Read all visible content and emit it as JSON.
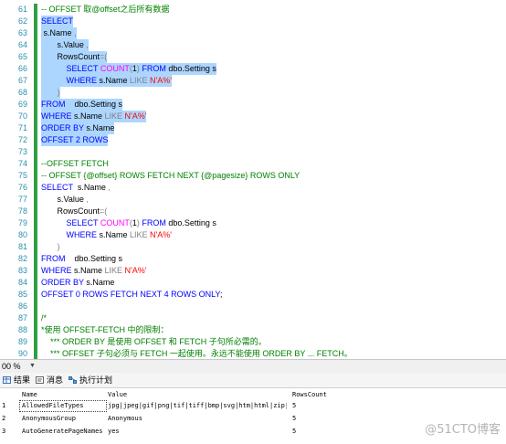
{
  "editor": {
    "lines": [
      {
        "n": "61",
        "sel": false,
        "tokens": [
          {
            "t": "-- OFFSET 取@offset之后所有数据",
            "c": "cm"
          }
        ]
      },
      {
        "n": "62",
        "sel": true,
        "tokens": [
          {
            "t": "SELECT",
            "c": "kw"
          }
        ]
      },
      {
        "n": "63",
        "sel": true,
        "tokens": [
          {
            "t": " s.Name ",
            "c": ""
          },
          {
            "t": ",",
            "c": "op"
          }
        ]
      },
      {
        "n": "64",
        "sel": true,
        "tokens": [
          {
            "t": "       s.Value ",
            "c": ""
          },
          {
            "t": ",",
            "c": "op"
          }
        ]
      },
      {
        "n": "65",
        "sel": true,
        "tokens": [
          {
            "t": "       RowsCount",
            "c": ""
          },
          {
            "t": "=(",
            "c": "op"
          }
        ]
      },
      {
        "n": "66",
        "sel": true,
        "tokens": [
          {
            "t": "           ",
            "c": ""
          },
          {
            "t": "SELECT ",
            "c": "kw"
          },
          {
            "t": "COUNT",
            "c": "fn"
          },
          {
            "t": "(",
            "c": "op"
          },
          {
            "t": "1",
            "c": ""
          },
          {
            "t": ") ",
            "c": "op"
          },
          {
            "t": "FROM ",
            "c": "kw"
          },
          {
            "t": "dbo.Setting s",
            "c": ""
          }
        ]
      },
      {
        "n": "67",
        "sel": true,
        "tokens": [
          {
            "t": "           ",
            "c": ""
          },
          {
            "t": "WHERE ",
            "c": "kw"
          },
          {
            "t": "s.Name ",
            "c": ""
          },
          {
            "t": "LIKE ",
            "c": "op"
          },
          {
            "t": "N'A%'",
            "c": "str"
          }
        ]
      },
      {
        "n": "68",
        "sel": true,
        "tokens": [
          {
            "t": "       ",
            "c": ""
          },
          {
            "t": ")",
            "c": "op"
          }
        ]
      },
      {
        "n": "69",
        "sel": true,
        "tokens": [
          {
            "t": "FROM ",
            "c": "kw"
          },
          {
            "t": "   dbo.Setting s",
            "c": ""
          }
        ]
      },
      {
        "n": "70",
        "sel": true,
        "tokens": [
          {
            "t": "WHERE ",
            "c": "kw"
          },
          {
            "t": "s.Name ",
            "c": ""
          },
          {
            "t": "LIKE ",
            "c": "op"
          },
          {
            "t": "N'A%'",
            "c": "str"
          }
        ]
      },
      {
        "n": "71",
        "sel": true,
        "tokens": [
          {
            "t": "ORDER BY ",
            "c": "kw"
          },
          {
            "t": "s.Name",
            "c": ""
          }
        ]
      },
      {
        "n": "72",
        "sel": true,
        "tokens": [
          {
            "t": "OFFSET 2 ROWS",
            "c": "kw"
          }
        ]
      },
      {
        "n": "73",
        "sel": false,
        "tokens": []
      },
      {
        "n": "74",
        "sel": false,
        "tokens": [
          {
            "t": "--OFFSET FETCH",
            "c": "cm"
          }
        ]
      },
      {
        "n": "75",
        "sel": false,
        "tokens": [
          {
            "t": "-- OFFSET {@offset} ROWS FETCH NEXT {@pagesize} ROWS ONLY",
            "c": "cm"
          }
        ]
      },
      {
        "n": "76",
        "sel": false,
        "tokens": [
          {
            "t": "SELECT ",
            "c": "kw"
          },
          {
            "t": " s.Name ",
            "c": ""
          },
          {
            "t": ",",
            "c": "op"
          }
        ]
      },
      {
        "n": "77",
        "sel": false,
        "tokens": [
          {
            "t": "       s.Value ",
            "c": ""
          },
          {
            "t": ",",
            "c": "op"
          }
        ]
      },
      {
        "n": "78",
        "sel": false,
        "tokens": [
          {
            "t": "       RowsCount",
            "c": ""
          },
          {
            "t": "=(",
            "c": "op"
          }
        ]
      },
      {
        "n": "79",
        "sel": false,
        "tokens": [
          {
            "t": "           ",
            "c": ""
          },
          {
            "t": "SELECT ",
            "c": "kw"
          },
          {
            "t": "COUNT",
            "c": "fn"
          },
          {
            "t": "(",
            "c": "op"
          },
          {
            "t": "1",
            "c": ""
          },
          {
            "t": ") ",
            "c": "op"
          },
          {
            "t": "FROM ",
            "c": "kw"
          },
          {
            "t": "dbo.Setting s",
            "c": ""
          }
        ]
      },
      {
        "n": "80",
        "sel": false,
        "tokens": [
          {
            "t": "           ",
            "c": ""
          },
          {
            "t": "WHERE ",
            "c": "kw"
          },
          {
            "t": "s.Name ",
            "c": ""
          },
          {
            "t": "LIKE ",
            "c": "op"
          },
          {
            "t": "N'A%'",
            "c": "str"
          }
        ]
      },
      {
        "n": "81",
        "sel": false,
        "tokens": [
          {
            "t": "       ",
            "c": ""
          },
          {
            "t": ")",
            "c": "op"
          }
        ]
      },
      {
        "n": "82",
        "sel": false,
        "tokens": [
          {
            "t": "FROM ",
            "c": "kw"
          },
          {
            "t": "   dbo.Setting s",
            "c": ""
          }
        ]
      },
      {
        "n": "83",
        "sel": false,
        "tokens": [
          {
            "t": "WHERE ",
            "c": "kw"
          },
          {
            "t": "s.Name ",
            "c": ""
          },
          {
            "t": "LIKE ",
            "c": "op"
          },
          {
            "t": "N'A%'",
            "c": "str"
          }
        ]
      },
      {
        "n": "84",
        "sel": false,
        "tokens": [
          {
            "t": "ORDER BY ",
            "c": "kw"
          },
          {
            "t": "s.Name",
            "c": ""
          }
        ]
      },
      {
        "n": "85",
        "sel": false,
        "tokens": [
          {
            "t": "OFFSET 0 ROWS FETCH NEXT 4 ROWS ONLY",
            "c": "kw"
          },
          {
            "t": ";",
            "c": ""
          }
        ]
      },
      {
        "n": "86",
        "sel": false,
        "tokens": []
      },
      {
        "n": "87",
        "sel": false,
        "tokens": [
          {
            "t": "/*",
            "c": "cm"
          }
        ]
      },
      {
        "n": "88",
        "sel": false,
        "tokens": [
          {
            "t": "*使用 OFFSET-FETCH 中的限制：",
            "c": "cm"
          }
        ]
      },
      {
        "n": "89",
        "sel": false,
        "tokens": [
          {
            "t": "    *** ORDER BY 是使用 OFFSET 和 FETCH 子句所必需的。",
            "c": "cm"
          }
        ]
      },
      {
        "n": "90",
        "sel": false,
        "tokens": [
          {
            "t": "    *** OFFSET 子句必须与 FETCH 一起使用。永远不能使用 ORDER BY ... FETCH。",
            "c": "cm"
          }
        ]
      }
    ]
  },
  "statusbar": {
    "zoom": "00 %"
  },
  "tabs": [
    {
      "label": "结果",
      "icon": "grid-icon"
    },
    {
      "label": "消息",
      "icon": "message-icon"
    },
    {
      "label": "执行计划",
      "icon": "execution-plan-icon"
    }
  ],
  "results": {
    "columns": [
      "Name",
      "Value",
      "RowsCount"
    ],
    "rows": [
      {
        "num": "1",
        "cells": [
          "AllowedFileTypes",
          "jpg|jpeg|gif|png|tif|tiff|bmp|svg|htm|html|zip|...",
          "5"
        ]
      },
      {
        "num": "2",
        "cells": [
          "AnonymousGroup",
          "Anonymous",
          "5"
        ]
      },
      {
        "num": "3",
        "cells": [
          "AutoGeneratePageNames",
          "yes",
          "5"
        ]
      }
    ]
  },
  "watermark": "@51CTO博客",
  "colors": {
    "keyword": "#0000ff",
    "function": "#ff00ff",
    "string": "#ff0000",
    "comment": "#008000",
    "selection": "#add6ff",
    "line_number": "#2b91af"
  }
}
